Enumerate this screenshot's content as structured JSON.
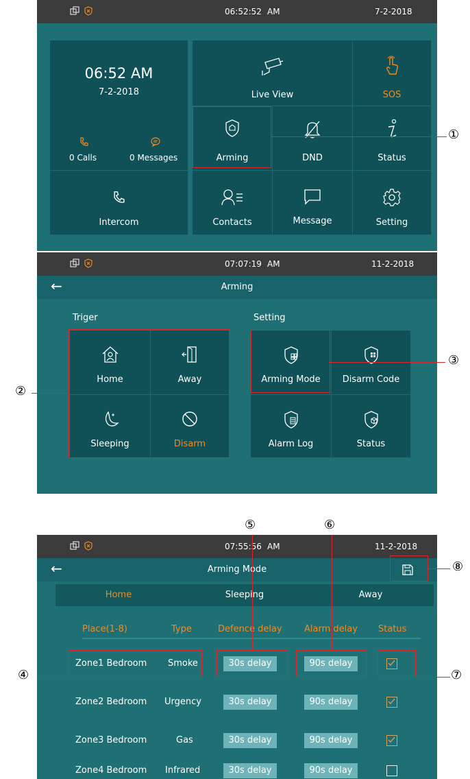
{
  "screen1": {
    "statusbar": {
      "time": "06:52:52",
      "ampm": "AM",
      "date": "7-2-2018"
    },
    "clock": {
      "time": "06:52 AM",
      "date": "7-2-2018"
    },
    "calls": "0 Calls",
    "messages": "0 Messages",
    "tiles": {
      "live_view": "Live View",
      "sos": "SOS",
      "arming": "Arming",
      "dnd": "DND",
      "status": "Status",
      "intercom": "Intercom",
      "contacts": "Contacts",
      "message": "Message",
      "setting": "Setting"
    }
  },
  "screen2": {
    "statusbar": {
      "time": "07:07:19",
      "ampm": "AM",
      "date": "11-2-2018"
    },
    "title": "Arming",
    "trigger_label": "Triger",
    "setting_label": "Setting",
    "trigger": {
      "home": "Home",
      "away": "Away",
      "sleeping": "Sleeping",
      "disarm": "Disarm"
    },
    "setting": {
      "arming_mode": "Arming Mode",
      "disarm_code": "Disarm Code",
      "alarm_log": "Alarm Log",
      "status": "Status"
    }
  },
  "screen3": {
    "statusbar": {
      "time": "07:55:56",
      "ampm": "AM",
      "date": "11-2-2018"
    },
    "title": "Arming Mode",
    "tabs": [
      "Home",
      "Sleeping",
      "Away"
    ],
    "headers": {
      "place": "Place(1-8)",
      "type": "Type",
      "defence": "Defence delay",
      "alarm": "Alarm delay",
      "status": "Status"
    },
    "rows": [
      {
        "place": "Zone1 Bedroom",
        "type": "Smoke",
        "defence": "30s delay",
        "alarm": "90s delay",
        "checked": true
      },
      {
        "place": "Zone2 Bedroom",
        "type": "Urgency",
        "defence": "30s delay",
        "alarm": "90s delay",
        "checked": true
      },
      {
        "place": "Zone3 Bedroom",
        "type": "Gas",
        "defence": "30s delay",
        "alarm": "90s delay",
        "checked": true
      },
      {
        "place": "Zone4 Bedroom",
        "type": "Infrared",
        "defence": "30s delay",
        "alarm": "90s delay",
        "checked": false
      }
    ]
  },
  "callouts": {
    "c1": "①",
    "c2": "②",
    "c3": "③",
    "c4": "④",
    "c5": "⑤",
    "c6": "⑥",
    "c7": "⑦",
    "c8": "⑧"
  },
  "colors": {
    "background": "#1f7075",
    "tile": "#0f5156",
    "accent": "#f08a24",
    "highlight": "#d9262c",
    "chip": "#6eb3b8"
  },
  "icons": [
    "window-icon",
    "shield-x-icon",
    "camera-icon",
    "sos-hand-icon",
    "home-shield-icon",
    "dnd-bell-icon",
    "info-icon",
    "phone-icon",
    "contacts-icon",
    "message-icon",
    "gear-icon",
    "back-arrow-icon",
    "home-icon",
    "door-exit-icon",
    "moon-icon",
    "prohibit-icon",
    "save-icon"
  ]
}
